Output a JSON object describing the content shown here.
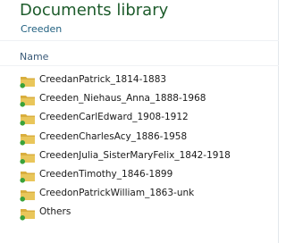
{
  "header": {
    "title": "Documents library",
    "subtitle": "Creeden"
  },
  "columns": {
    "name_label": "Name"
  },
  "items": [
    {
      "label": "CreedanPatrick_1814-1883"
    },
    {
      "label": "Creeden_Niehaus_Anna_1888-1968"
    },
    {
      "label": "CreedenCarlEdward_1908-1912"
    },
    {
      "label": "CreedenCharlesAcy_1886-1958"
    },
    {
      "label": "CreedenJulia_SisterMaryFelix_1842-1918"
    },
    {
      "label": "CreedenTimothy_1846-1899"
    },
    {
      "label": "CreedonPatrickWilliam_1863-unk"
    },
    {
      "label": "Others"
    }
  ],
  "colors": {
    "title": "#1e5c2c",
    "subtitle": "#1f5f7f",
    "folder_body": "#e9c65a",
    "folder_tab": "#d9ae3e",
    "sync_badge": "#3aa23a"
  },
  "icons": {
    "folder": "folder-icon",
    "badge": "sync-status-icon"
  }
}
